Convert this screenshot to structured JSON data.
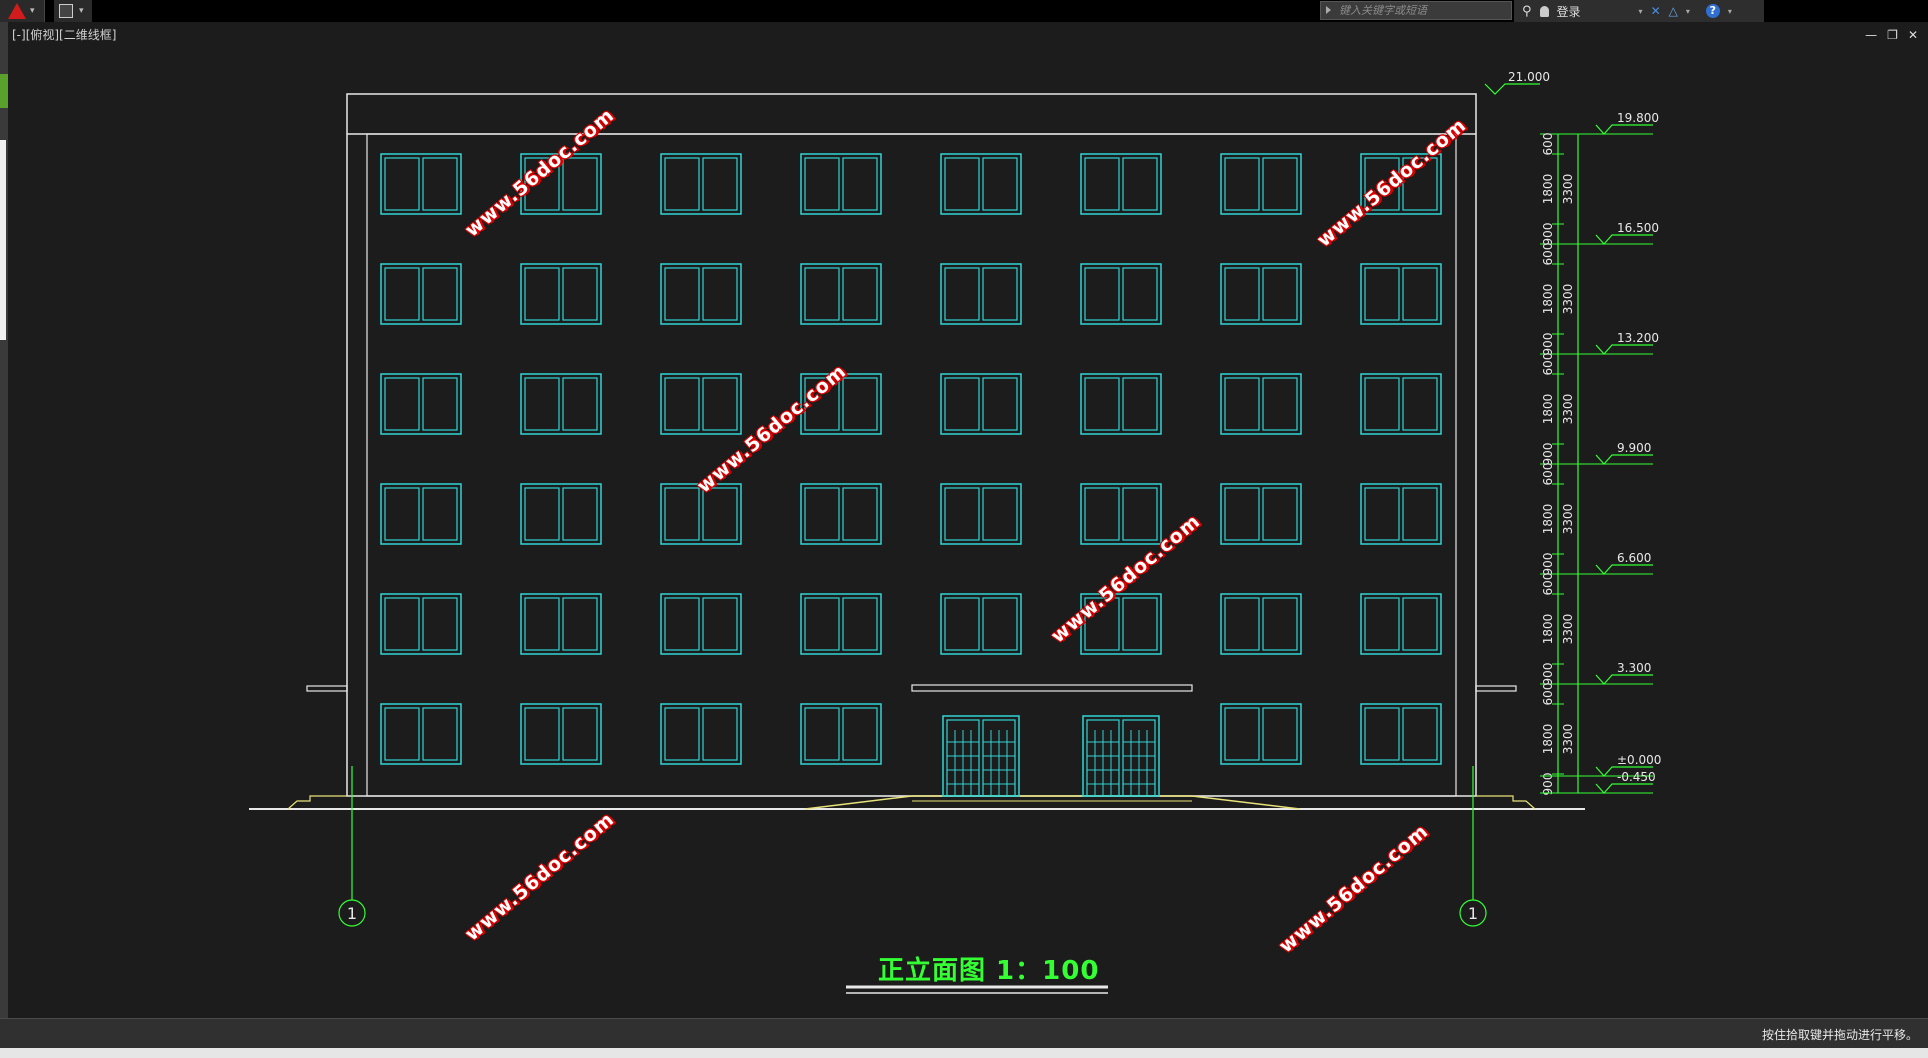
{
  "app": {
    "search_placeholder": "键入关键字或短语",
    "login_label": "登录",
    "viewport_label": "[-][俯视][二维线框]",
    "win_min": "—",
    "win_restore": "❐",
    "win_close": "✕",
    "status_text": "按住拾取键并拖动进行平移。"
  },
  "drawing": {
    "title": "正立面图 1：100",
    "watermark": "www.56doc.com",
    "axis_label_left": "1",
    "axis_label_right": "1",
    "top_elevation": "21.000",
    "levels": [
      "19.800",
      "16.500",
      "13.200",
      "9.900",
      "6.600",
      "3.300",
      "±0.000",
      "-0.450"
    ],
    "segment_dims": [
      "600",
      "1800",
      "900"
    ],
    "floor_dim": "3300",
    "floors": 6,
    "window_columns": 8
  },
  "colors": {
    "window": "#31d5d5",
    "outline": "#e8e8e8",
    "dimension": "#33ff33",
    "ground": "#e8e27a",
    "title": "#33ff33"
  }
}
